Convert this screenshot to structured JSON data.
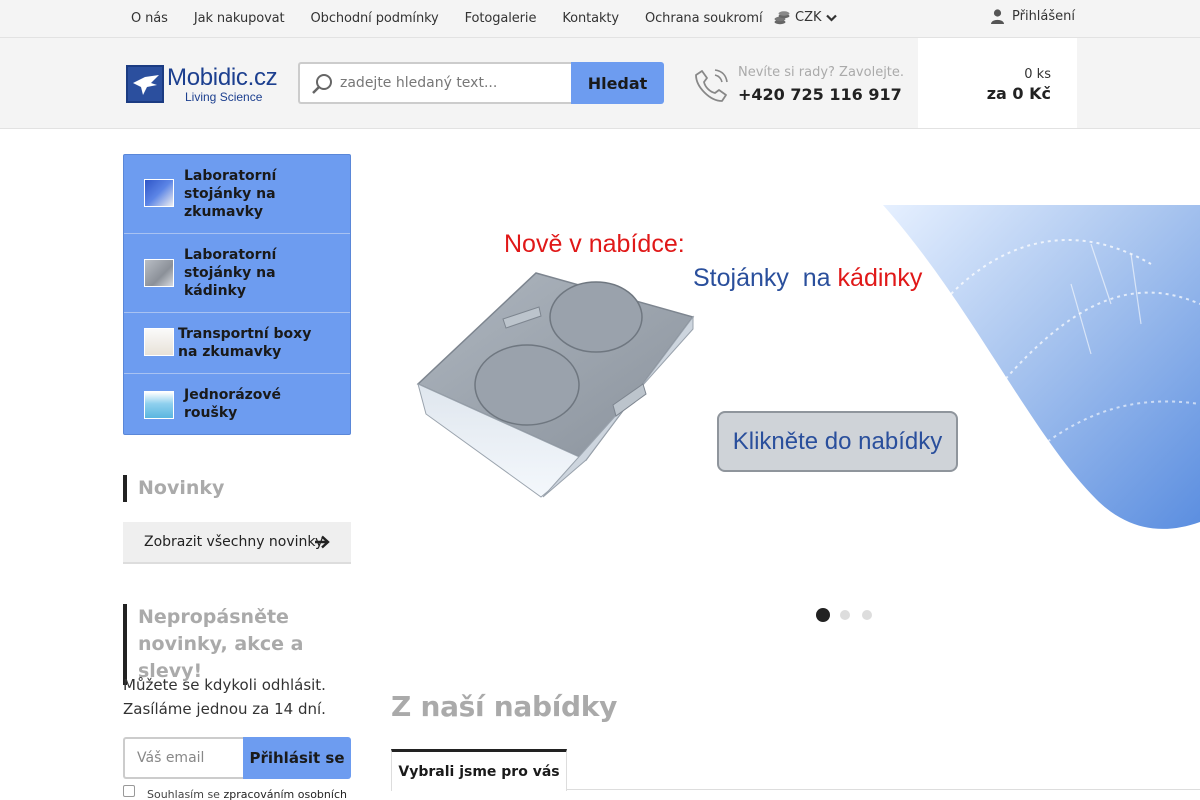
{
  "topnav": {
    "items": [
      "O nás",
      "Jak nakupovat",
      "Obchodní podmínky",
      "Fotogalerie",
      "Kontakty",
      "Ochrana soukromí"
    ],
    "currency": "CZK",
    "login": "Přihlášení"
  },
  "header": {
    "logo_name": "Mobidic.cz",
    "logo_tagline": "Living Science",
    "search_placeholder": "zadejte hledaný text...",
    "search_button": "Hledat",
    "phone_question": "Nevíte si rady? Zavolejte.",
    "phone_number": "+420 725 116 917",
    "cart_count": "0 ks",
    "cart_total": "za 0 Kč"
  },
  "categories": [
    {
      "label": "Laboratorní stojánky na zkumavky",
      "thumb": "tube-rack"
    },
    {
      "label": "Laboratorní stojánky na kádinky",
      "thumb": "beaker-rack"
    },
    {
      "label": "Transportní boxy na zkumavky",
      "thumb": "transport-box"
    },
    {
      "label": "Jednorázové roušky",
      "thumb": "face-mask"
    }
  ],
  "news": {
    "title": "Novinky",
    "button": "Zobrazit všechny novinky"
  },
  "newsletter": {
    "title": "Nepropásněte novinky, akce a slevy!",
    "text": "Můžete se kdykoli odhlásit. Zasíláme jednou za 14 dní.",
    "email_placeholder": "Váš email",
    "button": "Přihlásit se",
    "consent_prefix": "Souhlasím se",
    "consent_link": "zpracováním osobních"
  },
  "banner": {
    "headline": "Nově v nabídce:",
    "subline_a": "Stojánky  na",
    "subline_b": "kádinky",
    "cta": "Klikněte do nabídky",
    "slides_count": 3,
    "active_slide": 1
  },
  "offer": {
    "title": "Z naší nabídky",
    "tab": "Vybrali jsme pro vás"
  },
  "colors": {
    "accent": "#6d9cf0",
    "banner_red": "#e01818",
    "banner_blue": "#2a4f9c"
  }
}
